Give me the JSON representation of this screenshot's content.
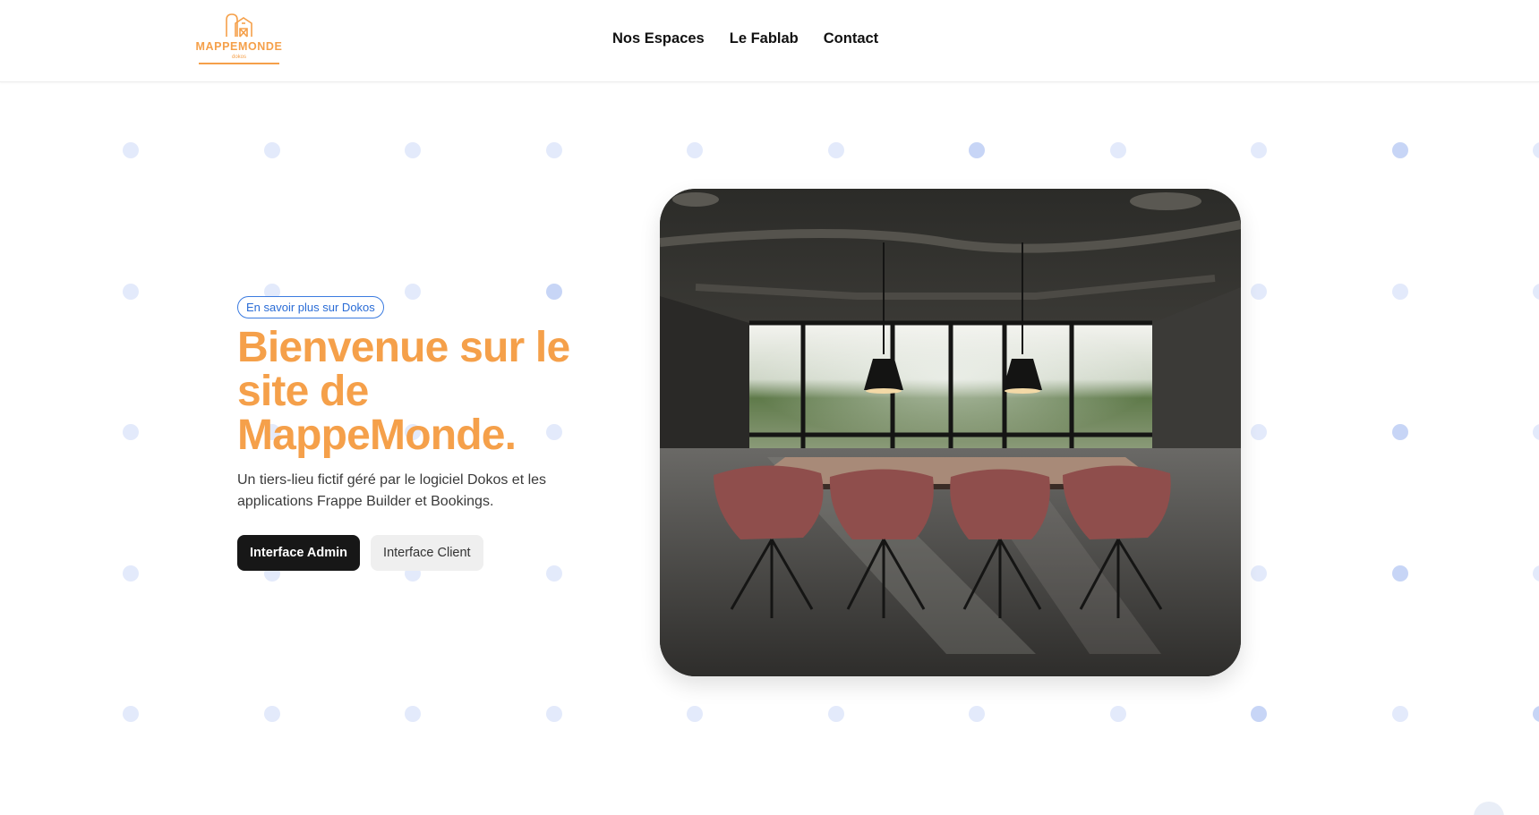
{
  "brand": {
    "logo_text": "MAPPEMONDE",
    "logo_subtext": "dokos",
    "color": "#f5a04a"
  },
  "nav": {
    "items": [
      {
        "label": "Nos Espaces"
      },
      {
        "label": "Le Fablab"
      },
      {
        "label": "Contact"
      }
    ]
  },
  "hero": {
    "pill_label": "En savoir plus sur Dokos",
    "title": "Bienvenue sur le site de MappeMonde.",
    "subtitle": "Un tiers-lieu fictif géré par le logiciel Dokos et les applications Frappe Builder et Bookings.",
    "primary_button": "Interface Admin",
    "secondary_button": "Interface Client",
    "image_subject": "meeting-room-photo"
  },
  "colors": {
    "accent": "#f5a04a",
    "link": "#2a6cd6",
    "primary_button_bg": "#171717",
    "dot": "#e3eafb",
    "dot_strong": "#c7d5f6"
  },
  "icons": {
    "logo": "barn-logo-icon",
    "help": "help-bubble-icon"
  }
}
